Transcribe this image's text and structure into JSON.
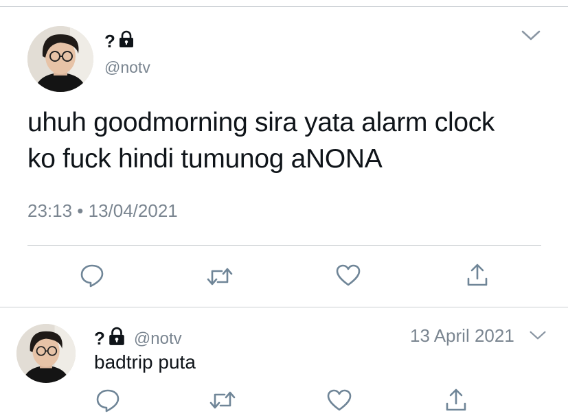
{
  "main_tweet": {
    "display_name": "?",
    "handle": "@notv",
    "text_line1": "uhuh goodmorning sira yata alarm clock",
    "text_line2": "ko fuck hindi tumunog aNONA",
    "timestamp": "23:13 • 13/04/2021"
  },
  "reply_tweet": {
    "display_name": "?",
    "handle": "@notv",
    "date": "13 April 2021",
    "text": "badtrip puta"
  },
  "icons": [
    "lock-icon",
    "chevron-down-icon",
    "reply-icon",
    "retweet-icon",
    "like-icon",
    "share-icon"
  ],
  "colors": {
    "text": "#0f1419",
    "secondary": "#7a8590",
    "icon": "#6f8597",
    "divider": "#cfd3d6"
  }
}
